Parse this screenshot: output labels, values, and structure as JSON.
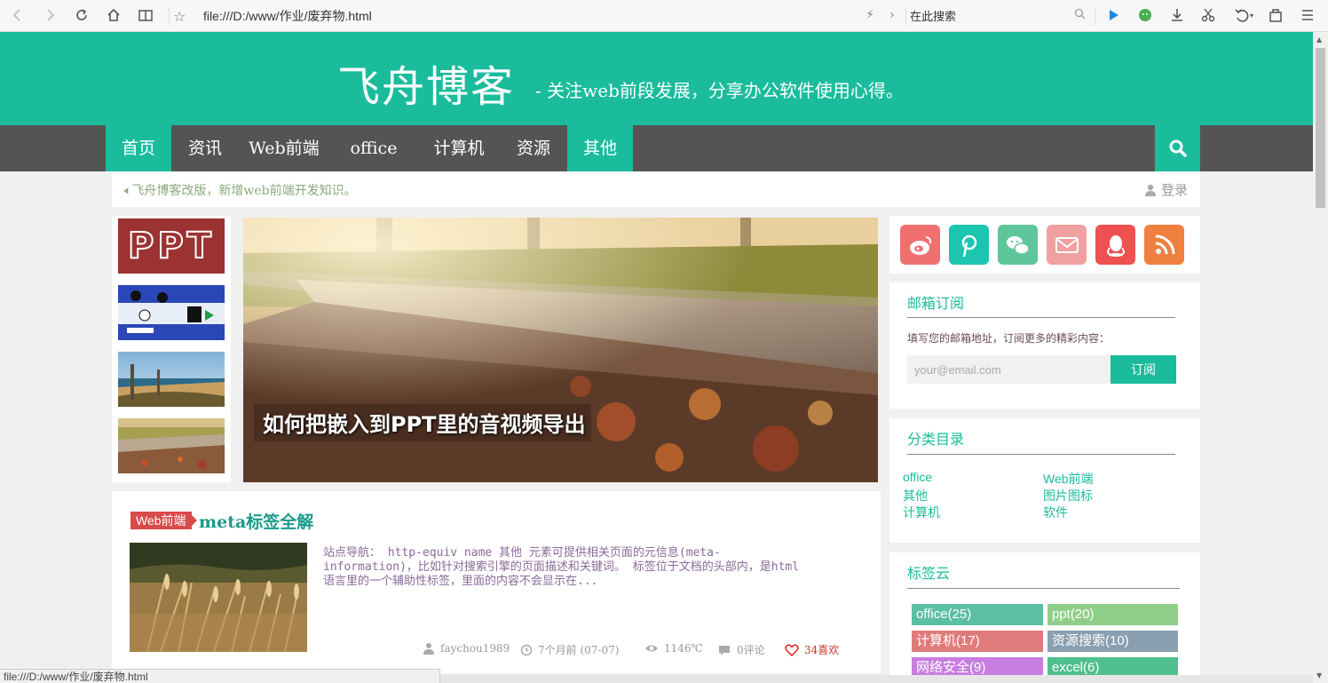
{
  "browser": {
    "url": "file:///D:/www/作业/废弃物.html",
    "search_placeholder": "在此搜索",
    "status_text": "file:///D:/www/作业/废弃物.html"
  },
  "header": {
    "brand": "飞舟博客",
    "tagline": "- 关注web前段发展，分享办公软件使用心得。"
  },
  "nav": {
    "items": [
      {
        "label": "首页",
        "active": true
      },
      {
        "label": "资讯",
        "active": false
      },
      {
        "label": "Web前端",
        "active": false
      },
      {
        "label": "office",
        "active": false
      },
      {
        "label": "计算机",
        "active": false
      },
      {
        "label": "资源",
        "active": false
      },
      {
        "label": "其他",
        "active": true
      }
    ]
  },
  "notice": {
    "text": "飞舟博客改版，新增web前端开发知识。",
    "login": "登录"
  },
  "slider": {
    "title": "如何把嵌入到PPT里的音视频导出"
  },
  "article": {
    "category": "Web前端",
    "title": "meta标签全解",
    "summary": "站点导航： http-equiv name 其他 元素可提供相关页面的元信息(meta-information)，比如针对搜索引擎的页面描述和关键词。 标签位于文档的头部内，是html语言里的一个辅助性标签，里面的内容不会显示在...",
    "author": "faychou1989",
    "time": "7个月前 (07-07)",
    "views": "1146℃",
    "comments": "0评论",
    "likes": "34喜欢"
  },
  "sidebar": {
    "subscribe": {
      "title": "邮箱订阅",
      "desc": "填写您的邮箱地址，订阅更多的精彩内容：",
      "placeholder": "your@email.com",
      "button": "订阅"
    },
    "categories": {
      "title": "分类目录",
      "items": [
        "office",
        "Web前端",
        "其他",
        "图片图标",
        "计算机",
        "软件"
      ]
    },
    "tags": {
      "title": "标签云",
      "items": [
        {
          "label": "office(25)",
          "color": "#5bbfa3"
        },
        {
          "label": "ppt(20)",
          "color": "#8fcf8a"
        },
        {
          "label": "计算机(17)",
          "color": "#e07b7b"
        },
        {
          "label": "资源搜索(10)",
          "color": "#8a9fb0"
        },
        {
          "label": "网络安全(9)",
          "color": "#c77ee0"
        },
        {
          "label": "excel(6)",
          "color": "#4fc08d"
        }
      ]
    }
  },
  "colors": {
    "accent": "#1abc9c",
    "nav_bg": "#545454"
  }
}
